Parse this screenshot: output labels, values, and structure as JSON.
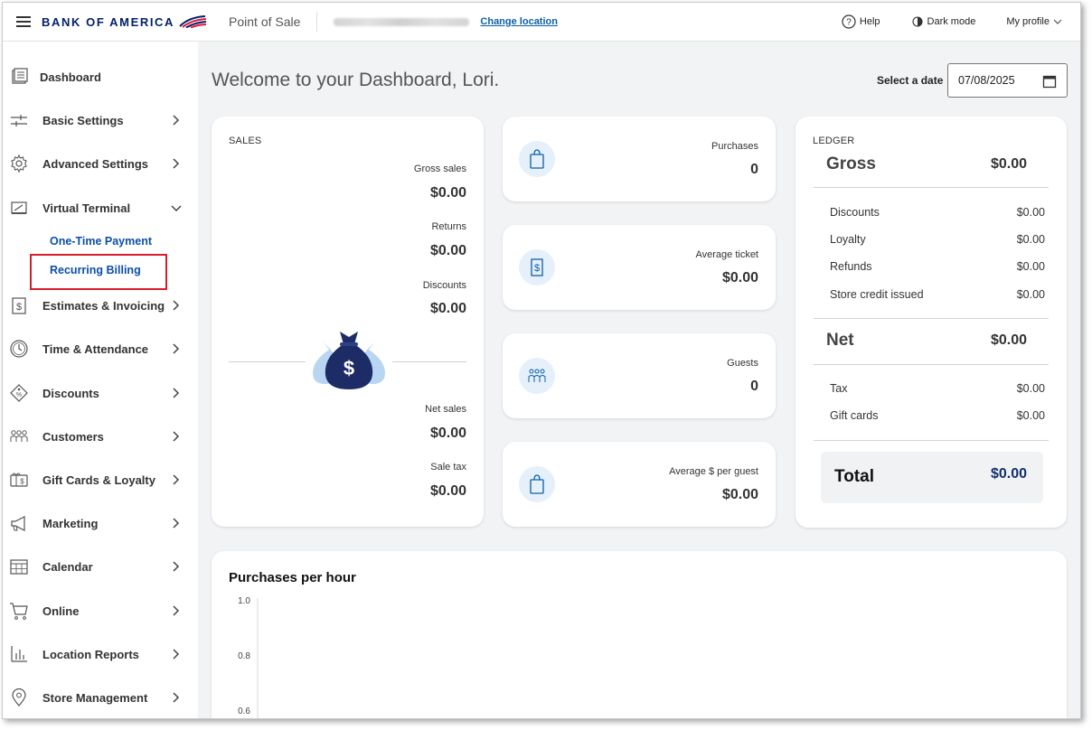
{
  "header": {
    "brand": "BANK OF AMERICA",
    "app_name": "Point of Sale",
    "change_location": "Change location",
    "help": "Help",
    "dark_mode": "Dark mode",
    "profile": "My profile"
  },
  "sidebar": {
    "items": [
      {
        "label": "Dashboard",
        "icon": "dashboard-icon"
      },
      {
        "label": "Basic Settings",
        "icon": "sliders-icon"
      },
      {
        "label": "Advanced Settings",
        "icon": "gear-icon"
      },
      {
        "label": "Virtual Terminal",
        "icon": "terminal-icon",
        "expanded": true
      },
      {
        "label": "Estimates & Invoicing",
        "icon": "invoice-icon"
      },
      {
        "label": "Time & Attendance",
        "icon": "clock-icon"
      },
      {
        "label": "Discounts",
        "icon": "tag-icon"
      },
      {
        "label": "Customers",
        "icon": "people-icon"
      },
      {
        "label": "Gift Cards & Loyalty",
        "icon": "gift-card-icon"
      },
      {
        "label": "Marketing",
        "icon": "megaphone-icon"
      },
      {
        "label": "Calendar",
        "icon": "calendar-icon"
      },
      {
        "label": "Online",
        "icon": "cart-icon"
      },
      {
        "label": "Location Reports",
        "icon": "bar-chart-icon"
      },
      {
        "label": "Store Management",
        "icon": "location-pin-icon"
      }
    ],
    "sub_items": [
      "One-Time Payment",
      "Recurring Billing"
    ]
  },
  "main": {
    "welcome": "Welcome to your Dashboard, Lori.",
    "date_label": "Select a date",
    "date_value": "07/08/2025"
  },
  "sales": {
    "title": "SALES",
    "gross_label": "Gross sales",
    "gross_value": "$0.00",
    "returns_label": "Returns",
    "returns_value": "$0.00",
    "discounts_label": "Discounts",
    "discounts_value": "$0.00",
    "net_label": "Net sales",
    "net_value": "$0.00",
    "tax_label": "Sale tax",
    "tax_value": "$0.00"
  },
  "stats": [
    {
      "label": "Purchases",
      "value": "0",
      "icon": "shopping-bag-icon"
    },
    {
      "label": "Average ticket",
      "value": "$0.00",
      "icon": "receipt-icon"
    },
    {
      "label": "Guests",
      "value": "0",
      "icon": "guests-icon"
    },
    {
      "label": "Average $ per guest",
      "value": "$0.00",
      "icon": "shopping-bag-icon"
    }
  ],
  "ledger": {
    "title": "LEDGER",
    "gross": {
      "label": "Gross",
      "value": "$0.00"
    },
    "rows1": [
      {
        "label": "Discounts",
        "value": "$0.00"
      },
      {
        "label": "Loyalty",
        "value": "$0.00"
      },
      {
        "label": "Refunds",
        "value": "$0.00"
      },
      {
        "label": "Store credit issued",
        "value": "$0.00"
      }
    ],
    "net": {
      "label": "Net",
      "value": "$0.00"
    },
    "rows2": [
      {
        "label": "Tax",
        "value": "$0.00"
      },
      {
        "label": "Gift cards",
        "value": "$0.00"
      }
    ],
    "total": {
      "label": "Total",
      "value": "$0.00"
    }
  },
  "chart_data": {
    "type": "bar",
    "title": "Purchases per hour",
    "y_ticks": [
      "1.0",
      "0.8",
      "0.6"
    ],
    "ylim": [
      0,
      1.0
    ],
    "categories": [],
    "values": [],
    "xlabel": "",
    "ylabel": "",
    "grid": false
  },
  "colors": {
    "brand_blue": "#012169",
    "brand_red": "#e31837",
    "link_blue": "#0b4fa8",
    "highlight_red": "#d81e2a",
    "icon_bg": "#e5f0fb"
  }
}
